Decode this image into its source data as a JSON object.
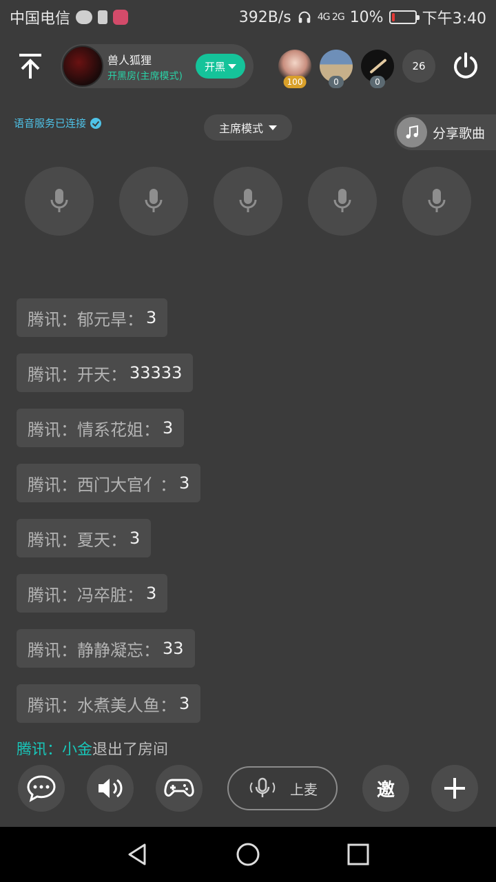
{
  "status_bar": {
    "carrier": "中国电信",
    "speed": "392B/s",
    "network": "4G 2G",
    "battery": "10%",
    "battery_level": 0.1,
    "time": "下午3:40"
  },
  "header": {
    "room_name": "兽人狐狸",
    "room_subtitle": "开黑房(主席模式)",
    "open_button": "开黑",
    "members": [
      {
        "badge": "100"
      },
      {
        "badge": "0"
      },
      {
        "badge": "0"
      }
    ],
    "member_count": "26"
  },
  "voice": {
    "status": "语音服务已连接",
    "mode": "主席模式",
    "share_label": "分享歌曲"
  },
  "messages": [
    {
      "source": "腾讯：",
      "name": "郁元旱",
      "content": "3"
    },
    {
      "source": "腾讯：",
      "name": "开天",
      "content": "33333"
    },
    {
      "source": "腾讯：",
      "name": "情系花姐",
      "content": "3"
    },
    {
      "source": "腾讯：",
      "name": "西门大官亻",
      "content": "3"
    },
    {
      "source": "腾讯：",
      "name": "夏天",
      "content": "3"
    },
    {
      "source": "腾讯：",
      "name": "冯卒脏",
      "content": "3"
    },
    {
      "source": "腾讯：",
      "name": "静静凝忘",
      "content": "33"
    },
    {
      "source": "腾讯：",
      "name": "水煮美人鱼",
      "content": "3"
    }
  ],
  "system_message": {
    "source": "腾讯：",
    "user": "小金",
    "text": "退出了房间"
  },
  "toolbar": {
    "mic_label": "上麦",
    "invite_label": "邀"
  }
}
